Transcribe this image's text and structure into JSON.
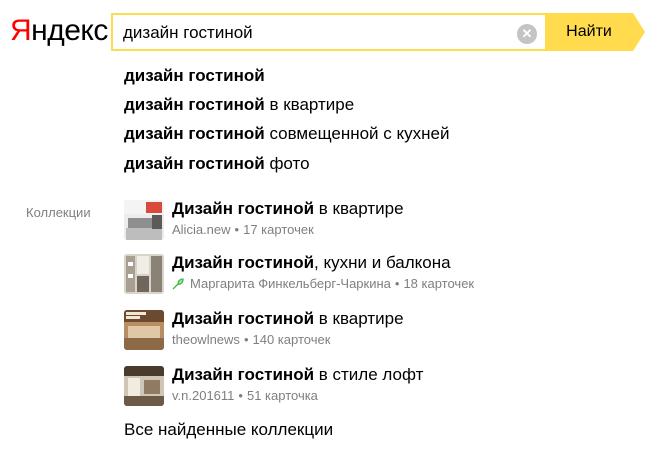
{
  "logo": {
    "first_letter": "Я",
    "rest": "ндекс"
  },
  "search": {
    "query": "дизайн гостиной",
    "button_label": "Найти",
    "clear_icon": "close-icon"
  },
  "suggestions": [
    {
      "bold": "дизайн гостиной",
      "rest": ""
    },
    {
      "bold": "дизайн гостиной",
      "rest": " в квартире"
    },
    {
      "bold": "дизайн гостиной",
      "rest": " совмещенной с кухней"
    },
    {
      "bold": "дизайн гостиной",
      "rest": " фото"
    }
  ],
  "collections_label": "Коллекции",
  "collections": [
    {
      "title_bold": "Дизайн гостиной",
      "title_rest": " в квартире",
      "author": "Alicia.new",
      "count": "17 карточек"
    },
    {
      "title_bold": "Дизайн гостиной",
      "title_rest": ", кухни и балкона",
      "author": "Маргарита Финкельберг-Чаркина",
      "count": "18 карточек",
      "author_icon": "leaf-icon"
    },
    {
      "title_bold": "Дизайн гостиной",
      "title_rest": " в квартире",
      "author": "theowlnews",
      "count": "140 карточек"
    },
    {
      "title_bold": "Дизайн гостиной",
      "title_rest": " в стиле лофт",
      "author": "v.n.201611",
      "count": "51 карточка"
    }
  ],
  "all_collections_link": "Все найденные коллекции",
  "colors": {
    "accent": "#ffdb4d",
    "logo_red": "#ff0000",
    "meta_gray": "#7f7f7f"
  }
}
